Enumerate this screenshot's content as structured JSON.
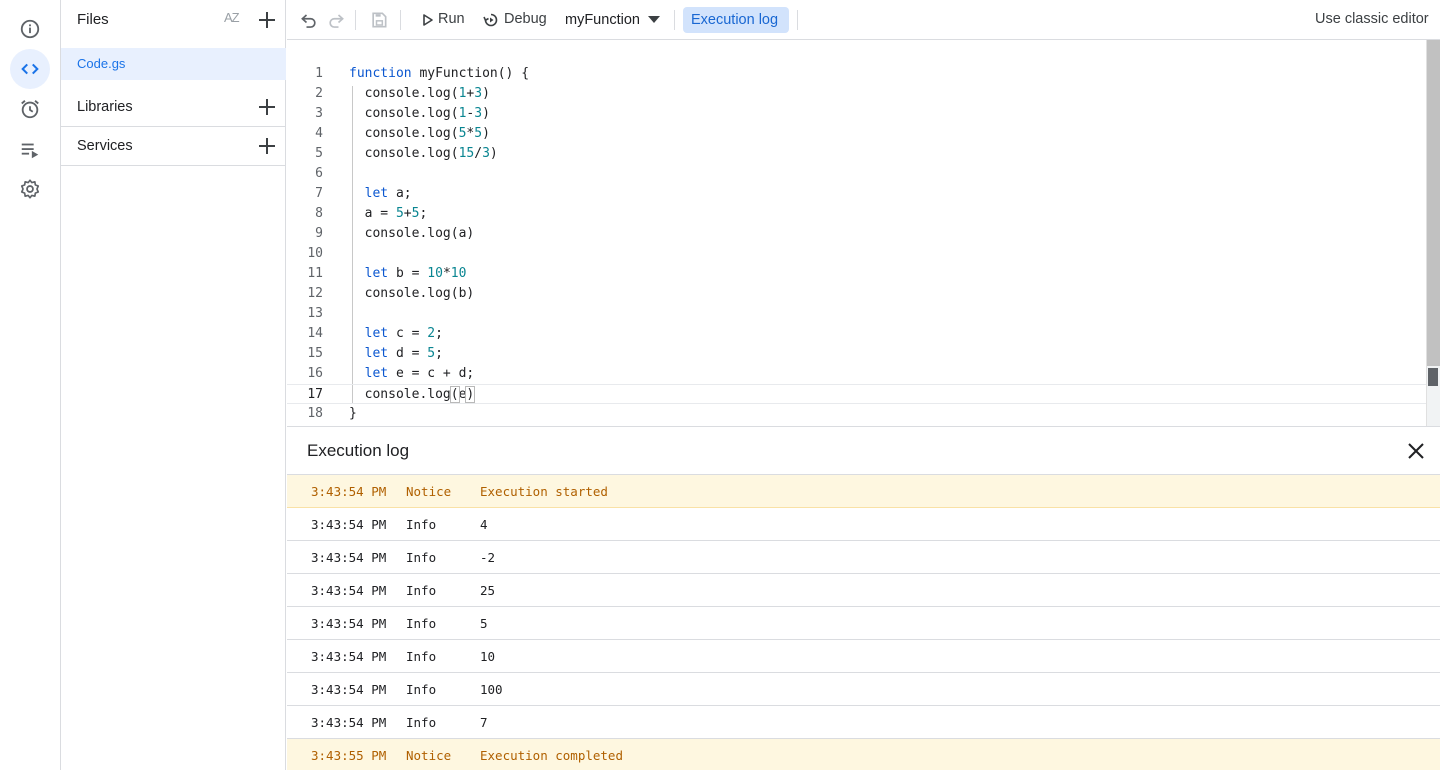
{
  "rail": {
    "items": [
      {
        "icon": "info-icon"
      },
      {
        "icon": "code-icon",
        "active": true
      },
      {
        "icon": "alarm-icon"
      },
      {
        "icon": "executions-icon"
      },
      {
        "icon": "gear-icon"
      }
    ]
  },
  "files": {
    "title": "Files",
    "sort_label": "AZ",
    "items": [
      {
        "label": "Code.gs",
        "selected": true
      }
    ],
    "sections": [
      {
        "label": "Libraries"
      },
      {
        "label": "Services"
      }
    ]
  },
  "toolbar": {
    "run_label": "Run",
    "debug_label": "Debug",
    "function_select": "myFunction",
    "execution_log_label": "Execution log",
    "classic_editor_label": "Use classic editor"
  },
  "editor": {
    "current_line": 17,
    "lines": [
      {
        "n": "1",
        "code": "function myFunction() {"
      },
      {
        "n": "2",
        "code": "  console.log(1+3)"
      },
      {
        "n": "3",
        "code": "  console.log(1-3)"
      },
      {
        "n": "4",
        "code": "  console.log(5*5)"
      },
      {
        "n": "5",
        "code": "  console.log(15/3)"
      },
      {
        "n": "6",
        "code": ""
      },
      {
        "n": "7",
        "code": "  let a;"
      },
      {
        "n": "8",
        "code": "  a = 5+5;"
      },
      {
        "n": "9",
        "code": "  console.log(a)"
      },
      {
        "n": "10",
        "code": ""
      },
      {
        "n": "11",
        "code": "  let b = 10*10"
      },
      {
        "n": "12",
        "code": "  console.log(b)"
      },
      {
        "n": "13",
        "code": ""
      },
      {
        "n": "14",
        "code": "  let c = 2;"
      },
      {
        "n": "15",
        "code": "  let d = 5;"
      },
      {
        "n": "16",
        "code": "  let e = c + d;"
      },
      {
        "n": "17",
        "code": "  console.log(e)"
      },
      {
        "n": "18",
        "code": "}"
      }
    ]
  },
  "log": {
    "title": "Execution log",
    "rows": [
      {
        "time": "3:43:54 PM",
        "severity": "Notice",
        "message": "Execution started"
      },
      {
        "time": "3:43:54 PM",
        "severity": "Info",
        "message": "4"
      },
      {
        "time": "3:43:54 PM",
        "severity": "Info",
        "message": "-2"
      },
      {
        "time": "3:43:54 PM",
        "severity": "Info",
        "message": "25"
      },
      {
        "time": "3:43:54 PM",
        "severity": "Info",
        "message": "5"
      },
      {
        "time": "3:43:54 PM",
        "severity": "Info",
        "message": "10"
      },
      {
        "time": "3:43:54 PM",
        "severity": "Info",
        "message": "100"
      },
      {
        "time": "3:43:54 PM",
        "severity": "Info",
        "message": "7"
      },
      {
        "time": "3:43:55 PM",
        "severity": "Notice",
        "message": "Execution completed"
      }
    ]
  },
  "colors": {
    "accent": "#1a73e8",
    "selected_bg": "#e8f0fe",
    "notice_bg": "#fef7e0",
    "notice_text": "#b06000",
    "keyword": "#0b57d0",
    "number": "#098591"
  }
}
